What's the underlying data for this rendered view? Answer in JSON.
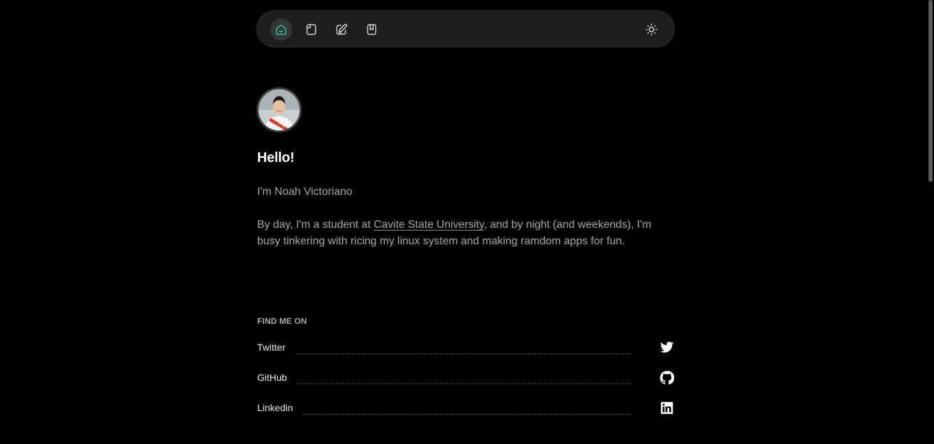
{
  "navbar": {
    "items": [
      {
        "icon": "home-icon",
        "active": true
      },
      {
        "icon": "projects-icon",
        "active": false
      },
      {
        "icon": "blog-icon",
        "active": false
      },
      {
        "icon": "bookmarks-icon",
        "active": false
      }
    ],
    "theme_toggle_icon": "sun-icon",
    "accent_color": "#2dd4bf"
  },
  "profile": {
    "title": "Hello!",
    "intro": "I'm Noah Victoriano",
    "bio_before": "By day, I'm a student at ",
    "bio_link": "Cavite State University",
    "bio_after": ", and by night (and weekends), I'm busy tinkering with ricing my linux system and making ramdom apps for fun."
  },
  "social": {
    "heading": "FIND ME ON",
    "links": [
      {
        "label": "Twitter",
        "icon": "twitter-icon"
      },
      {
        "label": "GitHub",
        "icon": "github-icon"
      },
      {
        "label": "Linkedin",
        "icon": "linkedin-icon"
      }
    ]
  }
}
